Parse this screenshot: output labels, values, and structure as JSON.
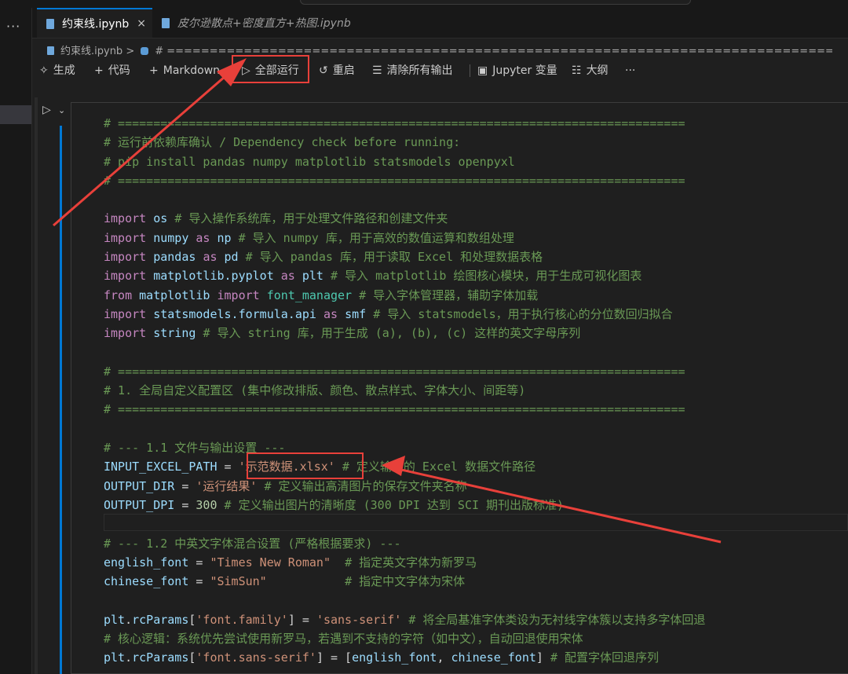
{
  "window": {
    "more_icon": "ellipsis-icon"
  },
  "tabs": [
    {
      "label": "约束线.ipynb",
      "close": "×",
      "active": true
    },
    {
      "label": "皮尔逊散点+密度直方+热图.ipynb",
      "active": false
    }
  ],
  "breadcrumb": {
    "file": "约束线.ipynb",
    "separator": ">",
    "symbol": "# ======================================================================================="
  },
  "toolbar": {
    "generate": "生成",
    "code": "代码",
    "markdown": "Markdown",
    "run_all": "全部运行",
    "restart": "重启",
    "clear_outputs": "清除所有输出",
    "jupyter_vars": "Jupyter 变量",
    "outline": "大纲",
    "more": "···"
  },
  "code_lines": [
    [
      [
        "c-com",
        "# ================================================================================"
      ]
    ],
    [
      [
        "c-com",
        "# 运行前依赖库确认 / Dependency check before running:"
      ]
    ],
    [
      [
        "c-com",
        "# pip install pandas numpy matplotlib statsmodels openpyxl"
      ]
    ],
    [
      [
        "c-com",
        "# ================================================================================"
      ]
    ],
    [],
    [
      [
        "c-kw",
        "import"
      ],
      [
        "c-def",
        " "
      ],
      [
        "c-id",
        "os"
      ],
      [
        "c-def",
        " "
      ],
      [
        "c-com",
        "# 导入操作系统库，用于处理文件路径和创建文件夹"
      ]
    ],
    [
      [
        "c-kw",
        "import"
      ],
      [
        "c-def",
        " "
      ],
      [
        "c-id",
        "numpy"
      ],
      [
        "c-def",
        " "
      ],
      [
        "c-kw",
        "as"
      ],
      [
        "c-def",
        " "
      ],
      [
        "c-id",
        "np"
      ],
      [
        "c-def",
        " "
      ],
      [
        "c-com",
        "# 导入 numpy 库，用于高效的数值运算和数组处理"
      ]
    ],
    [
      [
        "c-kw",
        "import"
      ],
      [
        "c-def",
        " "
      ],
      [
        "c-id",
        "pandas"
      ],
      [
        "c-def",
        " "
      ],
      [
        "c-kw",
        "as"
      ],
      [
        "c-def",
        " "
      ],
      [
        "c-id",
        "pd"
      ],
      [
        "c-def",
        " "
      ],
      [
        "c-com",
        "# 导入 pandas 库，用于读取 Excel 和处理数据表格"
      ]
    ],
    [
      [
        "c-kw",
        "import"
      ],
      [
        "c-def",
        " "
      ],
      [
        "c-id",
        "matplotlib.pyplot"
      ],
      [
        "c-def",
        " "
      ],
      [
        "c-kw",
        "as"
      ],
      [
        "c-def",
        " "
      ],
      [
        "c-id",
        "plt"
      ],
      [
        "c-def",
        " "
      ],
      [
        "c-com",
        "# 导入 matplotlib 绘图核心模块，用于生成可视化图表"
      ]
    ],
    [
      [
        "c-kw",
        "from"
      ],
      [
        "c-def",
        " "
      ],
      [
        "c-id",
        "matplotlib"
      ],
      [
        "c-def",
        " "
      ],
      [
        "c-kw",
        "import"
      ],
      [
        "c-def",
        " "
      ],
      [
        "c-fn",
        "font_manager"
      ],
      [
        "c-def",
        " "
      ],
      [
        "c-com",
        "# 导入字体管理器，辅助字体加载"
      ]
    ],
    [
      [
        "c-kw",
        "import"
      ],
      [
        "c-def",
        " "
      ],
      [
        "c-id",
        "statsmodels.formula.api"
      ],
      [
        "c-def",
        " "
      ],
      [
        "c-kw",
        "as"
      ],
      [
        "c-def",
        " "
      ],
      [
        "c-id",
        "smf"
      ],
      [
        "c-def",
        " "
      ],
      [
        "c-com",
        "# 导入 statsmodels，用于执行核心的分位数回归拟合"
      ]
    ],
    [
      [
        "c-kw",
        "import"
      ],
      [
        "c-def",
        " "
      ],
      [
        "c-id",
        "string"
      ],
      [
        "c-def",
        " "
      ],
      [
        "c-com",
        "# 导入 string 库，用于生成 (a), (b), (c) 这样的英文字母序列"
      ]
    ],
    [],
    [
      [
        "c-com",
        "# ================================================================================"
      ]
    ],
    [
      [
        "c-com",
        "# 1. 全局自定义配置区 (集中修改排版、颜色、散点样式、字体大小、间距等)"
      ]
    ],
    [
      [
        "c-com",
        "# ================================================================================"
      ]
    ],
    [],
    [
      [
        "c-com",
        "# --- 1.1 文件与输出设置 ---"
      ]
    ],
    [
      [
        "c-id",
        "INPUT_EXCEL_PATH"
      ],
      [
        "c-def",
        " = "
      ],
      [
        "c-str",
        "'示范数据.xlsx'"
      ],
      [
        "c-def",
        " "
      ],
      [
        "c-com",
        "# 定义输入的 Excel 数据文件路径"
      ]
    ],
    [
      [
        "c-id",
        "OUTPUT_DIR"
      ],
      [
        "c-def",
        " = "
      ],
      [
        "c-str",
        "'运行结果'"
      ],
      [
        "c-def",
        " "
      ],
      [
        "c-com",
        "# 定义输出高清图片的保存文件夹名称"
      ]
    ],
    [
      [
        "c-id",
        "OUTPUT_DPI"
      ],
      [
        "c-def",
        " = "
      ],
      [
        "c-num",
        "300"
      ],
      [
        "c-def",
        " "
      ],
      [
        "c-com",
        "# 定义输出图片的清晰度 (300 DPI 达到 SCI 期刊出版标准)"
      ]
    ],
    [],
    [
      [
        "c-com",
        "# --- 1.2 中英文字体混合设置 (严格根据要求) ---"
      ]
    ],
    [
      [
        "c-id",
        "english_font"
      ],
      [
        "c-def",
        " = "
      ],
      [
        "c-str",
        "\"Times New Roman\""
      ],
      [
        "c-def",
        "  "
      ],
      [
        "c-com",
        "# 指定英文字体为新罗马"
      ]
    ],
    [
      [
        "c-id",
        "chinese_font"
      ],
      [
        "c-def",
        " = "
      ],
      [
        "c-str",
        "\"SimSun\""
      ],
      [
        "c-def",
        "           "
      ],
      [
        "c-com",
        "# 指定中文字体为宋体"
      ]
    ],
    [],
    [
      [
        "c-id",
        "plt"
      ],
      [
        "c-def",
        "."
      ],
      [
        "c-id",
        "rcParams"
      ],
      [
        "c-def",
        "["
      ],
      [
        "c-str",
        "'font.family'"
      ],
      [
        "c-def",
        "] = "
      ],
      [
        "c-str",
        "'sans-serif'"
      ],
      [
        "c-def",
        " "
      ],
      [
        "c-com",
        "# 将全局基准字体类设为无衬线字体簇以支持多字体回退"
      ]
    ],
    [
      [
        "c-com",
        "# 核心逻辑：系统优先尝试使用新罗马，若遇到不支持的字符（如中文），自动回退使用宋体"
      ]
    ],
    [
      [
        "c-id",
        "plt"
      ],
      [
        "c-def",
        "."
      ],
      [
        "c-id",
        "rcParams"
      ],
      [
        "c-def",
        "["
      ],
      [
        "c-str",
        "'font.sans-serif'"
      ],
      [
        "c-def",
        "] = ["
      ],
      [
        "c-id",
        "english_font"
      ],
      [
        "c-def",
        ", "
      ],
      [
        "c-id",
        "chinese_font"
      ],
      [
        "c-def",
        "] "
      ],
      [
        "c-com",
        "# 配置字体回退序列"
      ]
    ]
  ]
}
